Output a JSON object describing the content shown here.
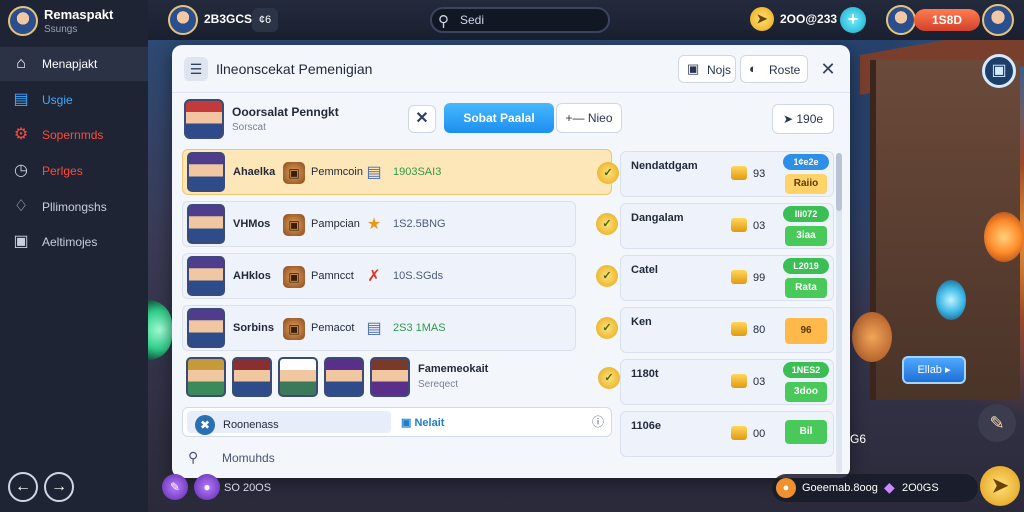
{
  "sidebar": {
    "title": "Remaspakt",
    "subtitle": "Ssungs",
    "items": [
      {
        "label": "Menapjakt",
        "icon": "home-icon",
        "color": "#ffffff",
        "active": true
      },
      {
        "label": "Usgie",
        "icon": "book-icon",
        "color": "#3fa9ff",
        "active": false
      },
      {
        "label": "Sopernmds",
        "icon": "gear-icon",
        "color": "#ff4a3a",
        "active": false
      },
      {
        "label": "Perlges",
        "icon": "clock-icon",
        "color": "#ff4a3a",
        "active": false
      },
      {
        "label": "Pllimongshs",
        "icon": "puzzle-icon",
        "color": "#c9cfdc",
        "active": false
      },
      {
        "label": "Aeltimojes",
        "icon": "briefcase-icon",
        "color": "#c9cfdc",
        "active": false
      }
    ]
  },
  "topbar": {
    "username": "2B3GCS",
    "user_chip": "¢6",
    "search_placeholder": "Sedi",
    "coins": "2OO@233",
    "gems": "1S8D"
  },
  "modal": {
    "title": "Ilneonscekat Pemenigian",
    "header_buttons": [
      {
        "label": "Nojs",
        "icon": "gift-icon"
      },
      {
        "label": "Roste",
        "icon": "shield-icon"
      }
    ],
    "player": {
      "name": "Ooorsalat Penngkt",
      "sub": "Sorscat",
      "primary_label": "Sobat Paalal",
      "secondary_label": "Nieo",
      "count_label": "190e"
    },
    "rows": [
      {
        "name": "Ahaelka",
        "role": "Pemmcoin",
        "role_icon": "chest-icon",
        "reward_icon": "book-icon",
        "amount": "1903SAI3",
        "highlight": true
      },
      {
        "name": "VHMos",
        "role": "Pampcian",
        "role_icon": "chest-icon",
        "reward_icon": "star-icon",
        "amount": "1S2.5BNG",
        "highlight": false
      },
      {
        "name": "AHklos",
        "role": "Pamncct",
        "role_icon": "chest-icon",
        "reward_icon": "x-icon",
        "amount": "10S.SGds",
        "highlight": false
      },
      {
        "name": "Sorbins",
        "role": "Pemacot",
        "role_icon": "chest-icon",
        "reward_icon": "book-icon",
        "amount": "2S3 1MAS",
        "highlight": false
      }
    ],
    "group": {
      "name": "Famemeokait",
      "sub": "Sereqect"
    },
    "bottom_row": {
      "left_label": "Roonenass",
      "mid_label": "Nelait"
    },
    "footer_label": "Momuhds",
    "side_panel": [
      {
        "label": "Nendatdgam",
        "qty": "93",
        "badge": "1¢e2e",
        "badge_color": "#2f8ee8",
        "button": "Raiio",
        "button_bg": "#ffd36a",
        "button_fg": "#5a3a00"
      },
      {
        "label": "Dangalam",
        "qty": "03",
        "badge": "lli072",
        "badge_color": "#3bbf55",
        "button": "3iaa",
        "button_bg": "#48c95a",
        "button_fg": "#ffffff"
      },
      {
        "label": "Catel",
        "qty": "99",
        "badge": "L2019",
        "badge_color": "#3bbf55",
        "button": "Rata",
        "button_bg": "#48c95a",
        "button_fg": "#ffffff"
      },
      {
        "label": "Ken",
        "qty": "80",
        "badge": "",
        "badge_color": "#3bbf55",
        "button": "96",
        "button_bg": "#ffb84a",
        "button_fg": "#5a3a00"
      },
      {
        "label": "1180t",
        "qty": "03",
        "badge": "1NES2",
        "badge_color": "#3bbf55",
        "button": "3doo",
        "button_bg": "#48c95a",
        "button_fg": "#ffffff"
      },
      {
        "label": "1106e",
        "qty": "00",
        "badge": "",
        "badge_color": "#3bbf55",
        "button": "Bil",
        "button_bg": "#48c95a",
        "button_fg": "#ffffff"
      }
    ]
  },
  "game": {
    "blue_button": "Ellab",
    "small_label": "G6",
    "bottom_text1": "Goeemab.8oog",
    "bottom_text2": "2O0GS",
    "bottom_left_text": "SO 20OS"
  },
  "colors": {
    "accent": "#1d8ef0",
    "highlight_row": "#fde7b8",
    "sidebar_bg": "#1e2434"
  }
}
